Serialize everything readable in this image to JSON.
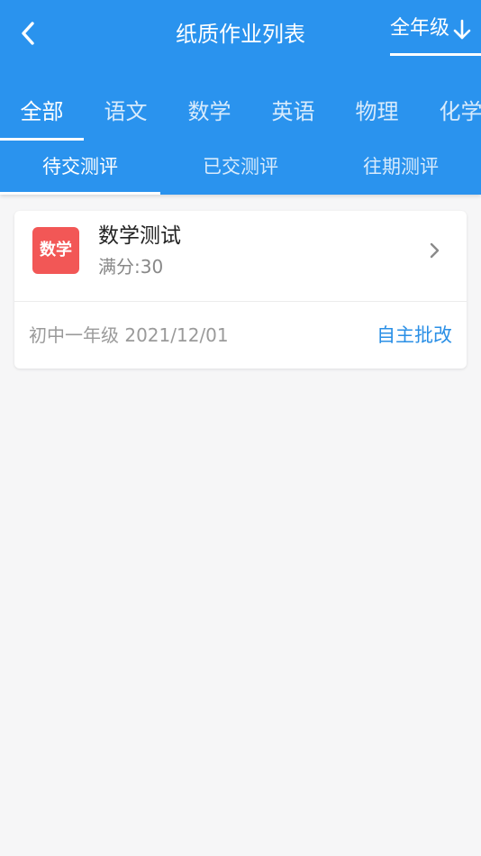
{
  "header": {
    "title": "纸质作业列表",
    "back_icon": "chevron-left-icon",
    "grade_filter": {
      "label": "全年级",
      "icon": "arrow-down-icon"
    },
    "background": "#2a93ee"
  },
  "subject_tabs": [
    {
      "label": "全部",
      "active": true
    },
    {
      "label": "语文",
      "active": false
    },
    {
      "label": "数学",
      "active": false
    },
    {
      "label": "英语",
      "active": false
    },
    {
      "label": "物理",
      "active": false
    },
    {
      "label": "化学",
      "active": false
    }
  ],
  "status_tabs": [
    {
      "label": "待交测评",
      "active": true
    },
    {
      "label": "已交测评",
      "active": false
    },
    {
      "label": "往期测评",
      "active": false
    }
  ],
  "homework_list": [
    {
      "badge": "数学",
      "badge_color": "#f25756",
      "title": "数学测试",
      "score": "满分:30",
      "grade_date": "初中一年级 2021/12/01",
      "action": "自主批改",
      "action_color": "#2a8fe6"
    }
  ]
}
